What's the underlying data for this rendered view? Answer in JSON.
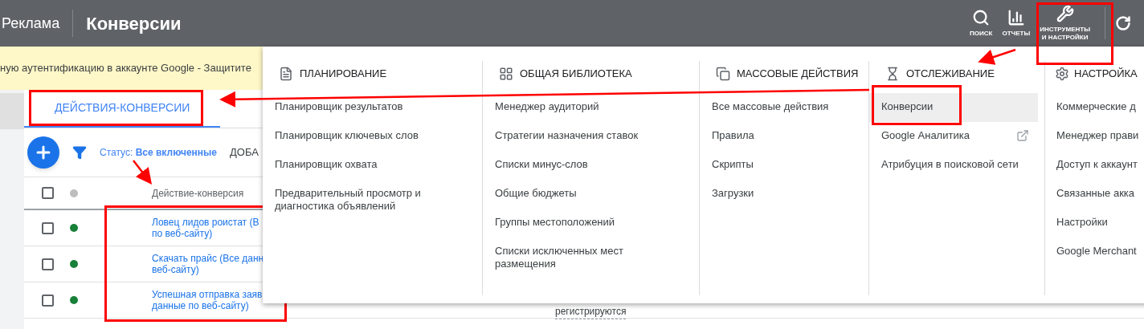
{
  "header": {
    "product": "Реклама",
    "title": "Конверсии",
    "tools": [
      {
        "kind": "search",
        "lines": [
          "ПОИСК"
        ]
      },
      {
        "kind": "chart",
        "lines": [
          "ОТЧЕТЫ"
        ]
      },
      {
        "kind": "wrench",
        "lines": [
          "ИНСТРУМЕНТЫ",
          "И НАСТРОЙКИ"
        ]
      }
    ]
  },
  "banner": {
    "text": "ную аутентификацию в аккаунте Google - Защитите"
  },
  "tabs": [
    {
      "label": "ДЕЙСТВИЯ-КОНВЕРСИИ",
      "selected": true
    }
  ],
  "toolbar": {
    "status_label": "Статус:",
    "status_value": "Все включенные",
    "action": "ДОБА"
  },
  "table": {
    "header_checked": false,
    "columns": [
      "Действие-конверсия"
    ],
    "rows": [
      {
        "lines": [
          "Ловец лидов роистат (В",
          "по веб-сайту)"
        ],
        "checked": false,
        "color": "#188038"
      },
      {
        "lines": [
          "Скачать прайс (Все данн",
          "веб-сайту)"
        ],
        "checked": false,
        "color": "#188038"
      },
      {
        "lines": [
          "Успешная отправка заяв",
          "данные по веб-сайту)"
        ],
        "checked": false,
        "color": "#188038",
        "column_4": "регистрируются"
      }
    ]
  },
  "menu": {
    "sections": [
      {
        "title": "ПЛАНИРОВАНИЕ",
        "kind": "planning",
        "items": [
          {
            "label": "Планировщик результатов",
            "selected": false,
            "external": false
          },
          {
            "label": "Планировщик ключевых слов",
            "selected": false,
            "external": false
          },
          {
            "label": "Планировщик охвата",
            "selected": false,
            "external": false
          },
          {
            "label": "Предварительный просмотр и диагностика объявлений",
            "selected": false,
            "external": false
          }
        ]
      },
      {
        "title": "ОБЩАЯ БИБЛИОТЕКА",
        "kind": "library",
        "items": [
          {
            "label": "Менеджер аудиторий",
            "selected": false,
            "external": false
          },
          {
            "label": "Стратегии назначения ставок",
            "selected": false,
            "external": false
          },
          {
            "label": "Списки минус-слов",
            "selected": false,
            "external": false
          },
          {
            "label": "Общие бюджеты",
            "selected": false,
            "external": false
          },
          {
            "label": "Группы местоположений",
            "selected": false,
            "external": false
          },
          {
            "label": "Списки исключенных мест размещения",
            "selected": false,
            "external": false
          }
        ]
      },
      {
        "title": "МАССОВЫЕ ДЕЙСТВИЯ",
        "kind": "bulk",
        "items": [
          {
            "label": "Все массовые действия",
            "selected": false,
            "external": false
          },
          {
            "label": "Правила",
            "selected": false,
            "external": false
          },
          {
            "label": "Скрипты",
            "selected": false,
            "external": false
          },
          {
            "label": "Загрузки",
            "selected": false,
            "external": false
          }
        ]
      },
      {
        "title": "ОТСЛЕЖИВАНИЕ",
        "kind": "tracking",
        "items": [
          {
            "label": "Конверсии",
            "selected": true,
            "external": false
          },
          {
            "label": "Google Аналитика",
            "selected": false,
            "external": true
          },
          {
            "label": "Атрибуция в поисковой сети",
            "selected": false,
            "external": false
          }
        ]
      },
      {
        "title": "НАСТРОЙКА",
        "kind": "setup",
        "items": [
          {
            "label": "Коммерческие д",
            "selected": false,
            "external": false
          },
          {
            "label": "Менеджер прави",
            "selected": false,
            "external": false
          },
          {
            "label": "Доступ к аккаунт",
            "selected": false,
            "external": false
          },
          {
            "label": "Связанные акка",
            "selected": false,
            "external": false
          },
          {
            "label": "Настройки",
            "selected": false,
            "external": false
          },
          {
            "label": "Google Merchant",
            "selected": false,
            "external": false
          }
        ]
      }
    ]
  }
}
